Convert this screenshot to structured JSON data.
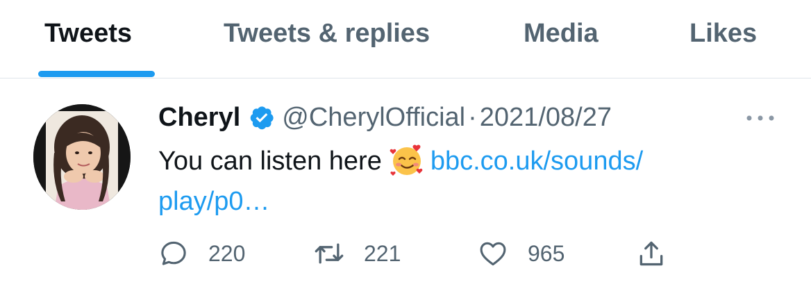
{
  "tabs": [
    {
      "label": "Tweets",
      "active": true
    },
    {
      "label": "Tweets & replies",
      "active": false
    },
    {
      "label": "Media",
      "active": false
    },
    {
      "label": "Likes",
      "active": false
    }
  ],
  "tweet": {
    "author_name": "Cheryl",
    "verified": true,
    "handle": "@CherylOfficial",
    "separator": "·",
    "date": "2021/08/27",
    "text": "You can listen here",
    "emoji": "smiling-face-with-hearts",
    "link_line1": "bbc.co.uk/sounds/",
    "link_line2": "play/p0…",
    "actions": {
      "replies": "220",
      "retweets": "221",
      "likes": "965"
    }
  },
  "colors": {
    "accent": "#1d9bf0",
    "text_primary": "#0f1419",
    "text_secondary": "#536471",
    "divider": "#dfe5ea"
  },
  "icons": [
    "verified-badge-icon",
    "more-icon",
    "reply-icon",
    "retweet-icon",
    "like-icon",
    "share-icon"
  ]
}
